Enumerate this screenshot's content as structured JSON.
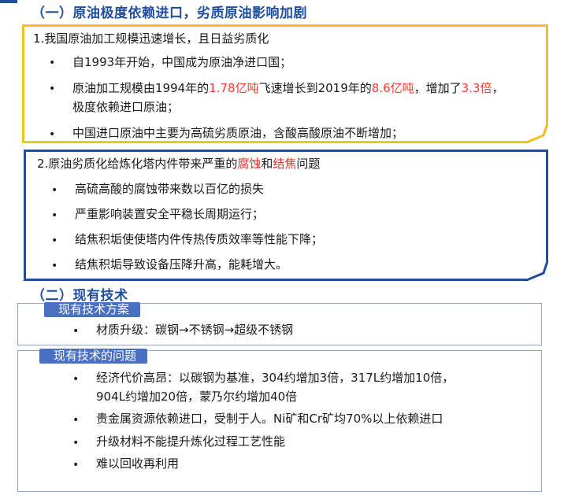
{
  "section1": {
    "title": "（一）原油极度依赖进口，劣质原油影响加剧"
  },
  "box1": {
    "heading": "1.我国原油加工规模迅速增长，且日益劣质化",
    "b1": "自1993年开始，中国成为原油净进口国；",
    "b2": {
      "p1": "原油加工规模由1994年的",
      "v1": "1.78亿吨",
      "p2": "飞速增长到2019年的",
      "v2": "8.6亿吨",
      "p3": "，增加了",
      "v3": "3.3倍",
      "p4": "，",
      "line2": "极度依赖进口原油；"
    },
    "b3": "中国进口原油中主要为高硫劣质原油，含酸高酸原油不断增加；"
  },
  "box2": {
    "heading_p1": "2.原油劣质化给炼化塔内件带来严重的",
    "heading_v1": "腐蚀",
    "heading_p2": "和",
    "heading_v2": "结焦",
    "heading_p3": "问题",
    "b1": "高硫高酸的腐蚀带来数以百亿的损失",
    "b2": "严重影响装置安全平稳长周期运行；",
    "b3": "结焦积垢使使塔内件传热传质效率等性能下降；",
    "b4": "结焦积垢导致设备压降升高，能耗增大。"
  },
  "section2": {
    "title": "（二）现有技术"
  },
  "box3": {
    "tab": "现有技术方案",
    "b1": "材质升级：碳钢→不锈钢→超级不锈钢"
  },
  "box4": {
    "tab": "现有技术的问题",
    "b1_line1": "经济代价高昂：以碳钢为基准，304约增加3倍，317L约增加10倍，",
    "b1_line2": "904L约增加20倍，蒙乃尔约增加40倍",
    "b2": "贵金属资源依赖进口，受制于人。Ni矿和Cr矿均70%以上依赖进口",
    "b3": "升级材料不能提升炼化过程工艺性能",
    "b4": "难以回收再利用"
  },
  "bullet_char": "•",
  "colors": {
    "title_blue": "#1f4e9c",
    "box1_border": "#f4c020",
    "box2_border": "#1f4e9c",
    "highlight_red": "#ff3b30",
    "tab_bg": "#4a70c4"
  }
}
